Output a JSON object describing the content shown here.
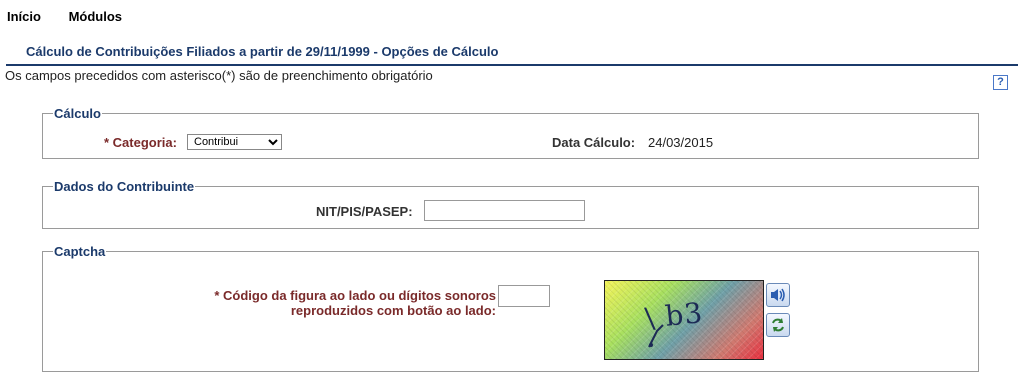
{
  "nav": {
    "inicio": "Início",
    "modulos": "Módulos"
  },
  "page": {
    "title": "Cálculo de Contribuições Filiados a partir de 29/11/1999 - Opções de Cálculo",
    "note": "Os campos precedidos com asterisco(*) são de preenchimento obrigatório",
    "help_icon": "?"
  },
  "calculo": {
    "legend": "Cálculo",
    "categoria_label": "* Categoria:",
    "categoria_value": "Contribui",
    "data_label": "Data Cálculo:",
    "data_value": "24/03/2015"
  },
  "contribuinte": {
    "legend": "Dados do Contribuinte",
    "nit_label": "NIT/PIS/PASEP:",
    "nit_value": ""
  },
  "captcha": {
    "legend": "Captcha",
    "label_line1": "* Código da figura ao lado ou dígitos sonoros",
    "label_line2": "reproduzidos com botão ao lado:",
    "code_value": "",
    "image_glyphs": "\\ b3",
    "audio_icon": "speaker-icon",
    "refresh_icon": "refresh-icon"
  }
}
